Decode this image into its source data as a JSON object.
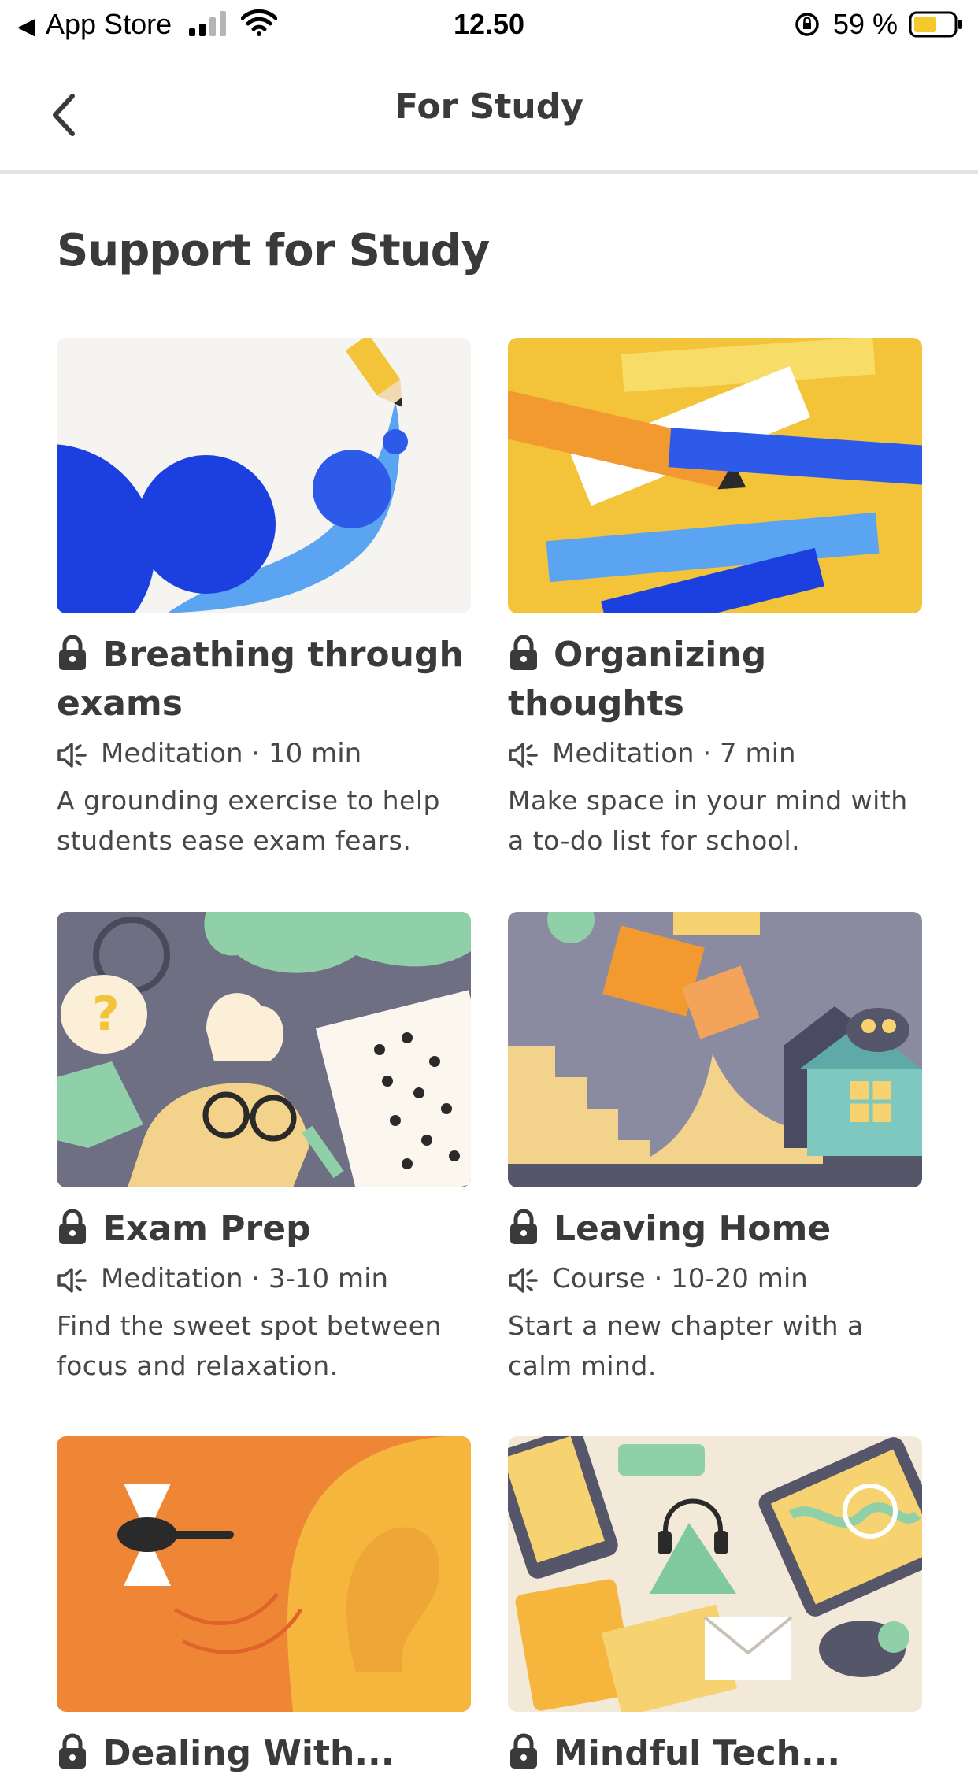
{
  "status_bar": {
    "back_app": "App Store",
    "time": "12.50",
    "battery": "59 %"
  },
  "nav": {
    "title": "For Study"
  },
  "section": {
    "title": "Support for Study"
  },
  "cards": [
    {
      "title": "Breathing through exams",
      "type": "Meditation",
      "duration": "10 min",
      "description": "A grounding exercise to help students ease exam fears.",
      "locked": true
    },
    {
      "title": "Organizing thoughts",
      "type": "Meditation",
      "duration": "7 min",
      "description": "Make space in your mind with a to-do list for school.",
      "locked": true
    },
    {
      "title": "Exam Prep",
      "type": "Meditation",
      "duration": "3-10 min",
      "description": "Find the sweet spot between focus and relaxation.",
      "locked": true
    },
    {
      "title": "Leaving Home",
      "type": "Course",
      "duration": "10-20 min",
      "description": "Start a new chapter with a calm mind.",
      "locked": true
    },
    {
      "title": "Dealing With...",
      "locked": true
    },
    {
      "title": "Mindful Tech...",
      "locked": true
    }
  ],
  "colors": {
    "text": "#3a3a3d",
    "divider": "#e3e3e6",
    "blue": "#1c3fe0",
    "yellow": "#f3c43a",
    "orange": "#ef8636"
  }
}
